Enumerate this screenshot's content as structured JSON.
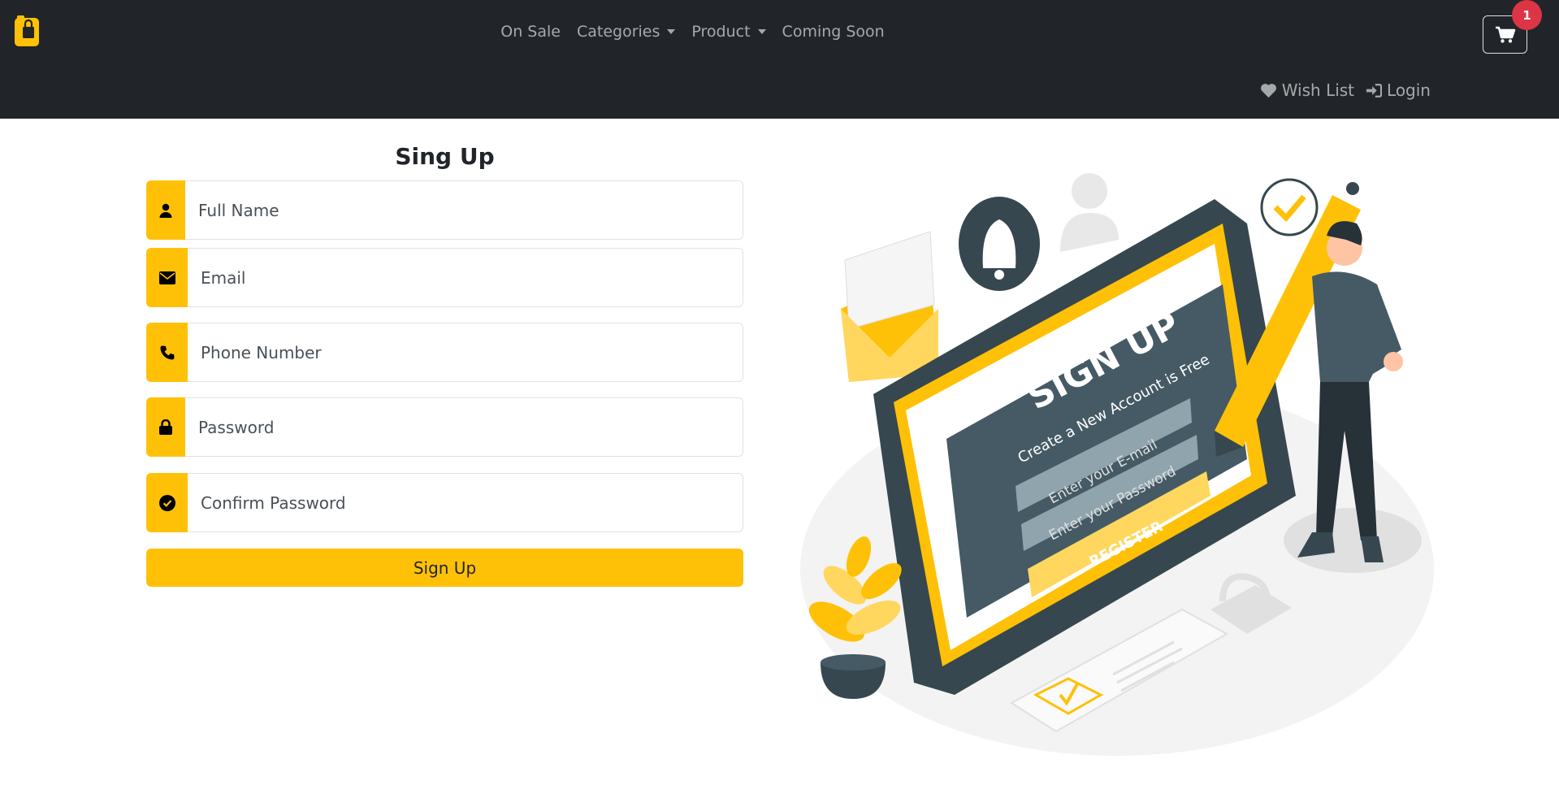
{
  "nav": {
    "brand_icon": "shopping-bag-icon",
    "links": [
      {
        "label": "On Sale"
      },
      {
        "label": "Categories"
      },
      {
        "label": "Product"
      },
      {
        "label": "Coming Soon"
      }
    ],
    "cart_count": "1",
    "wish_list": "Wish List",
    "login": "Login"
  },
  "form": {
    "title": "Sing Up",
    "fields": [
      {
        "placeholder": "Full Name",
        "icon": "user-icon"
      },
      {
        "placeholder": "Email",
        "icon": "envelope-icon"
      },
      {
        "placeholder": "Phone Number",
        "icon": "phone-icon"
      },
      {
        "placeholder": "Password",
        "icon": "lock-icon"
      },
      {
        "placeholder": "Confirm Password",
        "icon": "check-circle-icon"
      }
    ],
    "submit_label": "Sign Up"
  },
  "illustration": {
    "heading": "SIGN UP",
    "subheading": "Create a New Account is Free",
    "email_placeholder": "Enter your E-mail",
    "password_placeholder": "Enter your Password",
    "button": "REGISTER"
  },
  "colors": {
    "navbar": "#212529",
    "accent": "#ffc107",
    "badge": "#dc3545"
  }
}
